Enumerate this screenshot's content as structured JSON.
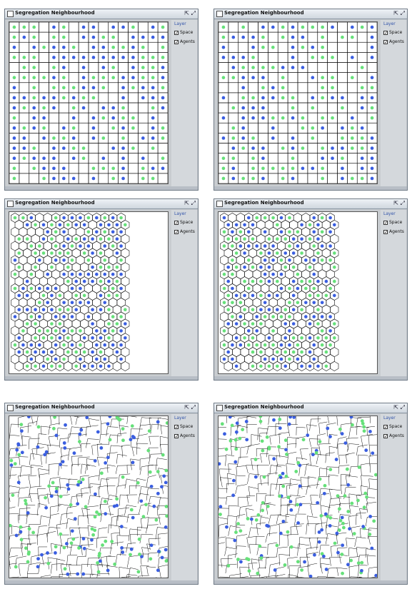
{
  "windows": [
    {
      "id": "w1",
      "title": "Segregation Neighbourhood",
      "grid": "square",
      "space_label": "Space",
      "agents_label": "Agents",
      "layer_label": "Layer"
    },
    {
      "id": "w2",
      "title": "Segregation Neighbourhood",
      "grid": "square-merged",
      "space_label": "Space",
      "agents_label": "Agents",
      "layer_label": "Layer"
    },
    {
      "id": "w3",
      "title": "Segregation Neighbourhood",
      "grid": "hexagonal",
      "space_label": "Space",
      "agents_label": "Agents",
      "layer_label": "Layer"
    },
    {
      "id": "w4",
      "title": "Segregation Neighbourhood",
      "grid": "hexagonal",
      "space_label": "Space",
      "agents_label": "Agents",
      "layer_label": "Layer"
    },
    {
      "id": "w5",
      "title": "Segregation Neighbourhood",
      "grid": "voronoi",
      "space_label": "Space",
      "agents_label": "Agents",
      "layer_label": "Layer"
    },
    {
      "id": "w6",
      "title": "Segregation Neighbourhood",
      "grid": "voronoi",
      "space_label": "Space",
      "agents_label": "Agents",
      "layer_label": "Layer"
    }
  ],
  "colors": {
    "agent_a": "#3a5ee0",
    "agent_b": "#66e07a",
    "grid": "#111111"
  },
  "icons": {
    "maximize": "maximize-icon",
    "detach": "detach-icon",
    "checkbox": "checkbox-checked-icon"
  }
}
